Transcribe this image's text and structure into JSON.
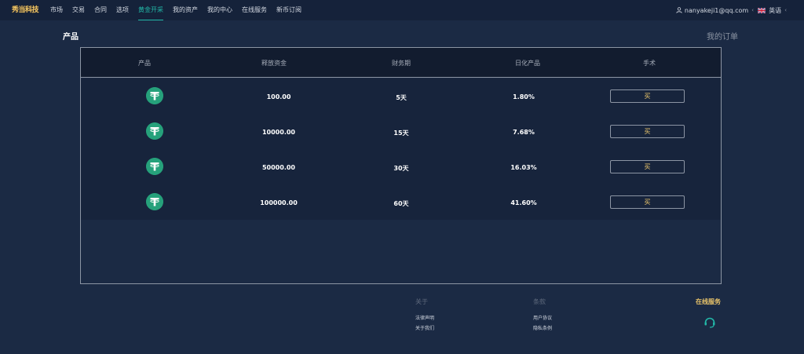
{
  "brand": {
    "logo_text": "秀当科技"
  },
  "nav": {
    "items": [
      "市场",
      "交易",
      "合同",
      "选项",
      "黄金开采",
      "我的资产",
      "我的中心",
      "在线服务",
      "新币订阅"
    ],
    "active_index": 4
  },
  "user": {
    "email": "nanyakeji1@qq.com",
    "language": "英语"
  },
  "page": {
    "title": "产品",
    "my_orders": "我的订单"
  },
  "table": {
    "headers": [
      "产品",
      "释放资金",
      "财务期",
      "日化产品",
      "手术"
    ],
    "rows": [
      {
        "amount": "100.00",
        "period": "5天",
        "rate": "1.80%",
        "action": "买"
      },
      {
        "amount": "10000.00",
        "period": "15天",
        "rate": "7.68%",
        "action": "买"
      },
      {
        "amount": "50000.00",
        "period": "30天",
        "rate": "16.03%",
        "action": "买"
      },
      {
        "amount": "100000.00",
        "period": "60天",
        "rate": "41.60%",
        "action": "买"
      }
    ]
  },
  "footer": {
    "about": {
      "title": "关于",
      "links": [
        "法律声明",
        "关于我们"
      ]
    },
    "terms": {
      "title": "条款",
      "links": [
        "用户协议",
        "隐私条例"
      ]
    },
    "online_service": "在线服务"
  },
  "colors": {
    "accent": "#22b8a8",
    "gold": "#e9c46a",
    "tether": "#26a17b",
    "background": "#1b2a44"
  },
  "icons": {
    "coin": "tether-icon",
    "user": "user-icon",
    "flag": "uk-flag-icon",
    "support": "headset-icon"
  }
}
